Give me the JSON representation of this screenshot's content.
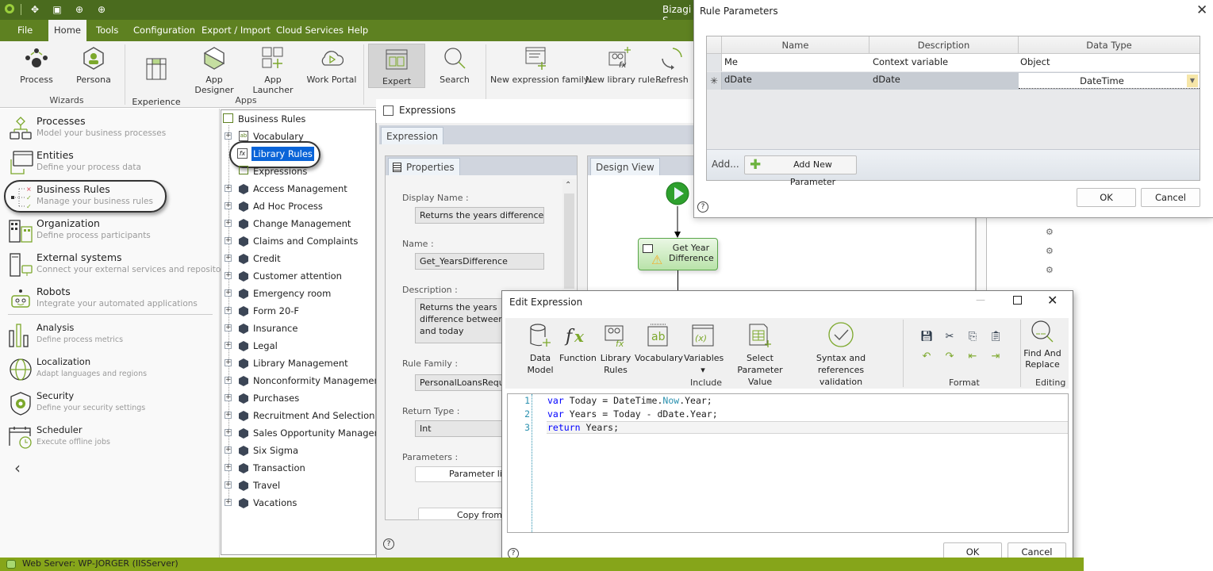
{
  "app": {
    "title": "Bizagi S",
    "menu": [
      "File",
      "Home",
      "Tools",
      "Configuration",
      "Export / Import",
      "Cloud Services",
      "Help"
    ],
    "active_menu": "Home",
    "quick_access_icons": [
      "bizagi-logo-icon",
      "process-icon",
      "window-icon",
      "upload-icon",
      "upload-icon"
    ]
  },
  "ribbon": {
    "buttons": [
      {
        "label": "Process",
        "icon": "process-wizard-icon"
      },
      {
        "label": "Persona",
        "icon": "persona-icon"
      },
      {
        "label": "Experience\nMatrix",
        "icon": "experience-matrix-icon"
      },
      {
        "label": "App Designer",
        "icon": "app-designer-icon"
      },
      {
        "label": "App Launcher",
        "icon": "app-launcher-icon"
      },
      {
        "label": "Work Portal",
        "icon": "work-portal-icon"
      },
      {
        "label": "Expert",
        "icon": "expert-view-icon",
        "active": true
      },
      {
        "label": "Search",
        "icon": "search-icon"
      },
      {
        "label": "New expression family...",
        "icon": "new-expression-family-icon"
      },
      {
        "label": "New library rule...",
        "icon": "new-library-rule-icon"
      },
      {
        "label": "Refresh",
        "icon": "refresh-icon"
      }
    ],
    "groups": [
      "Wizards",
      "Apps"
    ]
  },
  "leftnav": {
    "items": [
      {
        "title": "Processes",
        "subtitle": "Model your business processes"
      },
      {
        "title": "Entities",
        "subtitle": "Define your process data"
      },
      {
        "title": "Business Rules",
        "subtitle": "Manage your business rules",
        "highlighted": true
      },
      {
        "title": "Organization",
        "subtitle": "Define process participants"
      },
      {
        "title": "External systems",
        "subtitle": "Connect your external services and repositories"
      },
      {
        "title": "Robots",
        "subtitle": "Integrate your automated applications"
      },
      {
        "title": "Analysis",
        "subtitle": "Define process metrics"
      },
      {
        "title": "Localization",
        "subtitle": "Adapt languages and regions"
      },
      {
        "title": "Security",
        "subtitle": "Define your security settings"
      },
      {
        "title": "Scheduler",
        "subtitle": "Execute offline jobs"
      }
    ],
    "collapse_glyph": "‹"
  },
  "tree": {
    "root": "Business Rules",
    "children": [
      "Vocabulary",
      "Library Rules",
      "Expressions"
    ],
    "selected": "Library Rules",
    "processes": [
      "Access Management",
      "Ad Hoc Process",
      "Change Management",
      "Claims and Complaints",
      "Credit",
      "Customer attention",
      "Emergency room",
      "Form 20-F",
      "Insurance",
      "Legal",
      "Library Management",
      "Nonconformity Management",
      "Purchases",
      "Recruitment And Selection Process",
      "Sales Opportunity Management",
      "Six Sigma",
      "Transaction",
      "Travel",
      "Vacations"
    ]
  },
  "expressions": {
    "title": "Expressions",
    "tab": "Expression",
    "properties_tab": "Properties",
    "design_tab": "Design View",
    "fields": {
      "display_name_label": "Display Name :",
      "display_name": "Returns the years difference",
      "name_label": "Name :",
      "name": "Get_YearsDifference",
      "description_label": "Description :",
      "description": "Returns the years difference between a date and today",
      "rule_family_label": "Rule Family :",
      "rule_family": "PersonalLoansRequest",
      "return_type_label": "Return Type :",
      "return_type": "Int",
      "parameters_label": "Parameters :",
      "parameter_list_button": "Parameter list",
      "copy_from_button": "Copy from ..."
    },
    "diagram": {
      "task_label": "Get Year\nDifference"
    }
  },
  "rule_parameters": {
    "title": "Rule Parameters",
    "columns": [
      "Name",
      "Description",
      "Data Type"
    ],
    "rows": [
      {
        "name": "Me",
        "description": "Context variable",
        "data_type": "Object"
      },
      {
        "name": "dDate",
        "description": "dDate",
        "data_type": "DateTime",
        "editing": true
      }
    ],
    "add_label": "Add...",
    "add_new_button": "Add New Parameter",
    "ok": "OK",
    "cancel": "Cancel"
  },
  "edit_expression": {
    "title": "Edit Expression",
    "toolbar": {
      "include": [
        {
          "label": "Data\nModel",
          "icon": "data-model-icon"
        },
        {
          "label": "Function",
          "icon": "function-icon"
        },
        {
          "label": "Library\nRules",
          "icon": "library-rules-icon"
        },
        {
          "label": "Vocabulary",
          "icon": "vocabulary-icon"
        },
        {
          "label": "Variables\n▾",
          "icon": "variables-icon"
        },
        {
          "label": "Select Parameter\nValue",
          "icon": "select-parameter-icon"
        },
        {
          "label": "Syntax and references\nvalidation",
          "icon": "validation-icon"
        }
      ],
      "include_group": "Include",
      "format_group": "Format",
      "editing_group": "Editing",
      "find_replace": "Find And\nReplace"
    },
    "code": [
      {
        "n": "1",
        "parts": [
          [
            "kw",
            "var"
          ],
          [
            "t",
            " Today = DateTime."
          ],
          [
            "prop",
            "Now"
          ],
          [
            "t",
            ".Year;"
          ]
        ]
      },
      {
        "n": "2",
        "parts": [
          [
            "kw",
            "var"
          ],
          [
            "t",
            " Years = Today - dDate.Year;"
          ]
        ]
      },
      {
        "n": "3",
        "parts": [
          [
            "kw",
            "return"
          ],
          [
            "t",
            " Years;"
          ]
        ]
      }
    ],
    "ok": "OK",
    "cancel": "Cancel"
  },
  "status": {
    "text": "Web Server: WP-JORGER (IISServer)"
  }
}
